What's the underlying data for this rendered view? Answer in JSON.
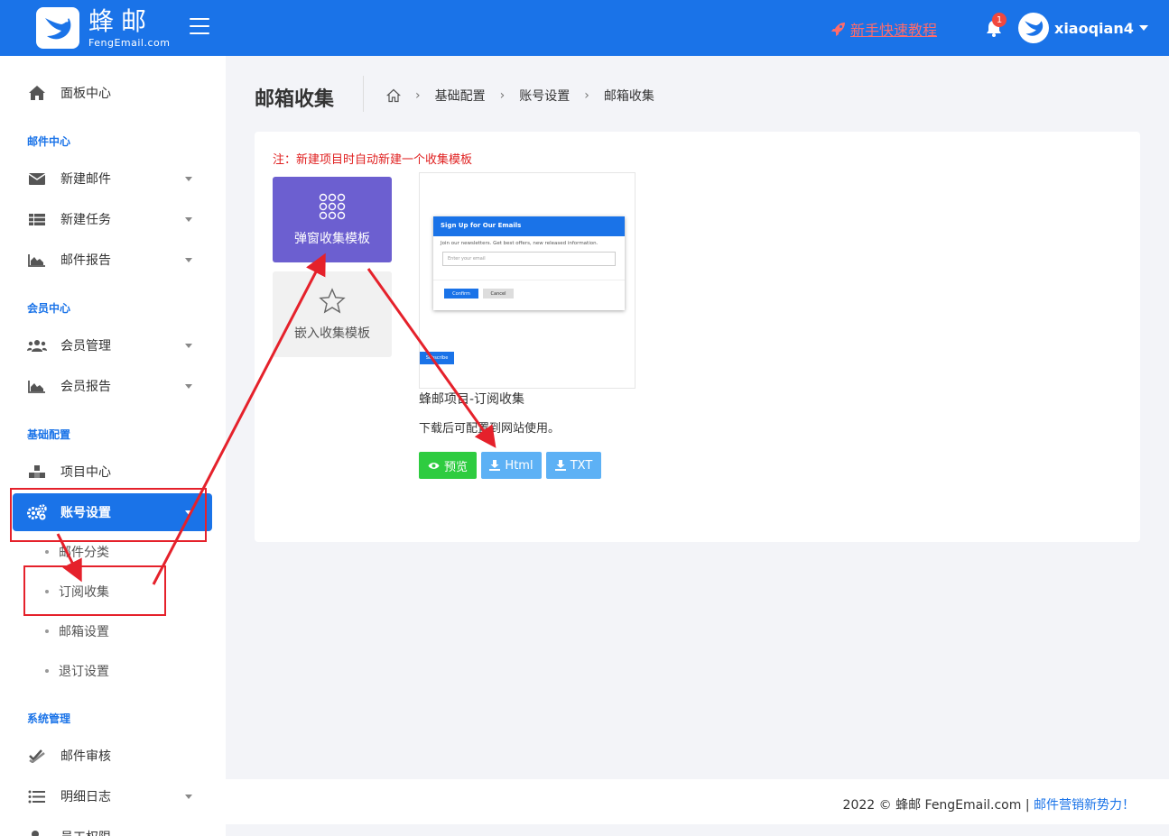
{
  "header": {
    "logo_cn": "蜂邮",
    "logo_en": "FengEmail.com",
    "tutorial": "新手快速教程",
    "notification_count": "1",
    "username": "xiaoqian4"
  },
  "sidebar": {
    "dashboard": "面板中心",
    "sections": {
      "mail_center": "邮件中心",
      "member_center": "会员中心",
      "basic_config": "基础配置",
      "system_mgmt": "系统管理"
    },
    "items": {
      "new_mail": "新建邮件",
      "new_task": "新建任务",
      "mail_report": "邮件报告",
      "member_mgmt": "会员管理",
      "member_report": "会员报告",
      "project_center": "项目中心",
      "account_settings": "账号设置",
      "mail_audit": "邮件审核",
      "detail_log": "明细日志",
      "staff_perm": "员工权限"
    },
    "sub_items": {
      "mail_category": "邮件分类",
      "subscribe_collect": "订阅收集",
      "mailbox_settings": "邮箱设置",
      "unsubscribe_settings": "退订设置"
    }
  },
  "page": {
    "title": "邮箱收集",
    "breadcrumb": [
      "基础配置",
      "账号设置",
      "邮箱收集"
    ]
  },
  "card": {
    "note": "注：新建项目时自动新建一个收集模板",
    "templates": {
      "popup": "弹窗收集模板",
      "embed": "嵌入收集模板"
    },
    "preview": {
      "modal_title": "Sign Up for Our Emails",
      "modal_desc": "Join our newsletters. Get best offers, new released information.",
      "input_placeholder": "Enter your email",
      "confirm": "Confirm",
      "cancel": "Cancel",
      "subscribe": "Subscribe"
    },
    "template_name": "蜂邮项目-订阅收集",
    "template_desc": "下载后可配置到网站使用。",
    "buttons": {
      "preview": "预览",
      "html": "Html",
      "txt": "TXT"
    }
  },
  "footer": {
    "copyright": "2022 © 蜂邮 FengEmail.com | ",
    "slogan": "邮件营销新势力！"
  },
  "colors": {
    "primary": "#1a73e8",
    "purple": "#6c5fd0",
    "green": "#2ecc40",
    "light_blue": "#5db1f5",
    "annotation_red": "#e5212b"
  }
}
